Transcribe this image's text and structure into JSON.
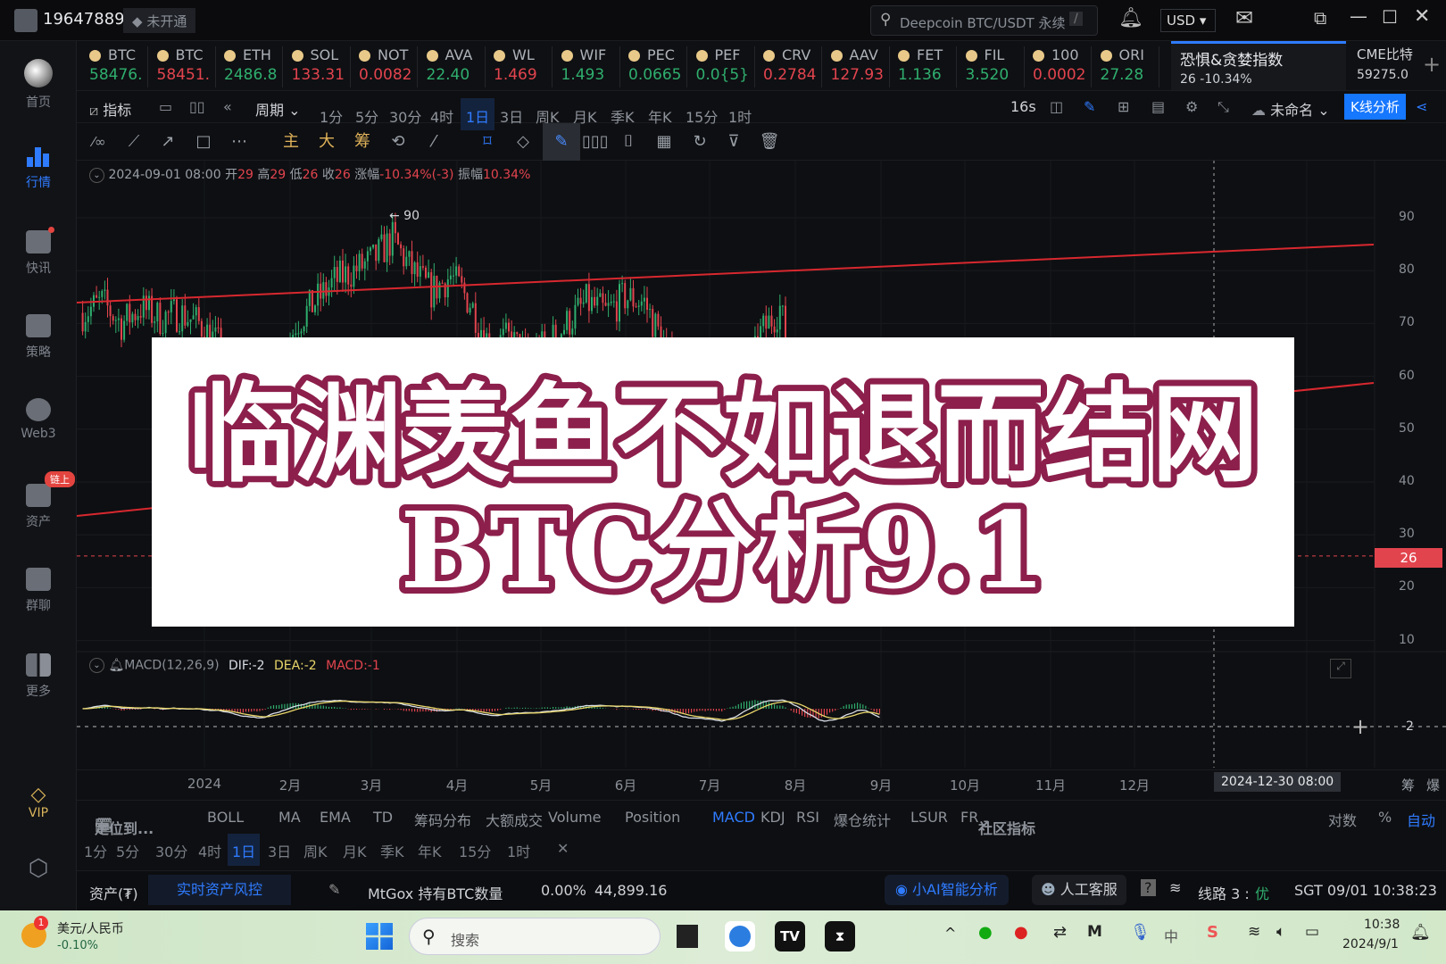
{
  "topbar": {
    "user_id": "19647889",
    "vip_status": "未开通",
    "search_placeholder": "Deepcoin BTC/USDT 永续",
    "search_shortcut": "/",
    "currency": "USD"
  },
  "sidebar": {
    "items": [
      {
        "label": "首页",
        "icon": "home-logo-icon"
      },
      {
        "label": "行情",
        "icon": "bar-chart-icon",
        "active": true
      },
      {
        "label": "快讯",
        "icon": "news-icon"
      },
      {
        "label": "策略",
        "icon": "robot-icon"
      },
      {
        "label": "Web3",
        "icon": "web3-icon"
      },
      {
        "label": "资产",
        "icon": "wallet-icon",
        "badge": "链上"
      },
      {
        "label": "群聊",
        "icon": "chat-icon"
      },
      {
        "label": "更多",
        "icon": "grid-icon"
      },
      {
        "label": "VIP",
        "icon": "diamond-icon"
      }
    ]
  },
  "ticker": [
    {
      "name": "BTC",
      "price": "58476.",
      "dir": "up"
    },
    {
      "name": "BTC",
      "price": "58451.",
      "dir": "down"
    },
    {
      "name": "ETH",
      "price": "2486.8",
      "dir": "up"
    },
    {
      "name": "SOL",
      "price": "133.31",
      "dir": "down"
    },
    {
      "name": "NOT",
      "price": "0.0082",
      "dir": "down"
    },
    {
      "name": "AVA",
      "price": "22.40",
      "dir": "up"
    },
    {
      "name": "WL",
      "price": "1.469",
      "dir": "down"
    },
    {
      "name": "WIF",
      "price": "1.493",
      "dir": "up"
    },
    {
      "name": "PEC",
      "price": "0.0665",
      "dir": "up"
    },
    {
      "name": "PEF",
      "price": "0.0{5}",
      "dir": "up"
    },
    {
      "name": "CRV",
      "price": "0.2784",
      "dir": "down"
    },
    {
      "name": "AAV",
      "price": "127.93",
      "dir": "down"
    },
    {
      "name": "FET",
      "price": "1.136",
      "dir": "up"
    },
    {
      "name": "FIL",
      "price": "3.520",
      "dir": "up"
    },
    {
      "name": "100",
      "price": "0.0002",
      "dir": "down"
    },
    {
      "name": "ORI",
      "price": "27.28",
      "dir": "up"
    }
  ],
  "fear_greed": {
    "title": "恐惧&贪婪指数",
    "value": "26 -10.34%"
  },
  "cme": {
    "title": "CME比特",
    "value": "59275.0"
  },
  "toolbar": {
    "indicators": "指标",
    "period": "周期",
    "periods": [
      "1分",
      "5分",
      "30分",
      "4时",
      "1日",
      "3日",
      "周K",
      "月K",
      "季K",
      "年K",
      "15分",
      "1时"
    ],
    "active_period": "1日",
    "refresh": "16s",
    "layout_name": "未命名",
    "kline_analysis": "K线分析",
    "main": "主",
    "big": "大",
    "chip": "筹"
  },
  "info": {
    "date": "2024-09-01 08:00",
    "open_label": "开",
    "open": "29",
    "high_label": "高",
    "high": "29",
    "low_label": "低",
    "low": "26",
    "close_label": "收",
    "close": "26",
    "change_label": "涨幅",
    "change": "-10.34%(-3)",
    "amp_label": "振幅",
    "amp": "10.34%"
  },
  "overlay": {
    "line1": "临渊羡鱼不如退而结网",
    "line2": "BTC分析9.1"
  },
  "macd": {
    "title": "MACD(12,26,9)",
    "dif": "DIF:-2",
    "dea": "DEA:-2",
    "macd": "MACD:-1",
    "axis_label": "-2"
  },
  "colors": {
    "up": "#2fae6e",
    "down": "#e2444e",
    "accent": "#2f7bff",
    "dif": "#d8dde6",
    "dea": "#e8d66a",
    "trendline": "#d8282f",
    "overlay_stroke": "#8c1f4b"
  },
  "chart_data": {
    "type": "candlestick",
    "yaxis": {
      "ticks": [
        90,
        80,
        70,
        60,
        50,
        40,
        30,
        20,
        10
      ],
      "range": [
        10,
        90
      ]
    },
    "last_price": "26",
    "peak_label": "← 90",
    "xaxis_ticks": [
      "2024",
      "2月",
      "3月",
      "4月",
      "5月",
      "6月",
      "7月",
      "8月",
      "9月",
      "10月",
      "11月",
      "12月",
      "2月"
    ],
    "crosshair_time": "2024-12-30 08:00",
    "weekly_close": [
      [
        "2023-11-18",
        72
      ],
      [
        "2023-11-25",
        74
      ],
      [
        "2023-12-02",
        70
      ],
      [
        "2023-12-09",
        73
      ],
      [
        "2023-12-16",
        71
      ],
      [
        "2023-12-23",
        72
      ],
      [
        "2023-12-30",
        70
      ],
      [
        "2024-01-06",
        66
      ],
      [
        "2024-01-13",
        55
      ],
      [
        "2024-01-20",
        50
      ],
      [
        "2024-01-27",
        60
      ],
      [
        "2024-02-03",
        70
      ],
      [
        "2024-02-10",
        74
      ],
      [
        "2024-02-17",
        78
      ],
      [
        "2024-02-24",
        80
      ],
      [
        "2024-03-02",
        82
      ],
      [
        "2024-03-09",
        86
      ],
      [
        "2024-03-16",
        80
      ],
      [
        "2024-03-23",
        76
      ],
      [
        "2024-03-30",
        79
      ],
      [
        "2024-04-06",
        74
      ],
      [
        "2024-04-13",
        66
      ],
      [
        "2024-04-20",
        67
      ],
      [
        "2024-04-27",
        64
      ],
      [
        "2024-05-04",
        66
      ],
      [
        "2024-05-11",
        70
      ],
      [
        "2024-05-18",
        74
      ],
      [
        "2024-05-25",
        72
      ],
      [
        "2024-06-01",
        75
      ],
      [
        "2024-06-08",
        74
      ],
      [
        "2024-06-15",
        66
      ],
      [
        "2024-06-22",
        55
      ],
      [
        "2024-06-29",
        48
      ],
      [
        "2024-07-06",
        40
      ],
      [
        "2024-07-13",
        55
      ],
      [
        "2024-07-20",
        68
      ],
      [
        "2024-07-27",
        73
      ],
      [
        "2024-08-03",
        55
      ],
      [
        "2024-08-10",
        35
      ],
      [
        "2024-08-17",
        42
      ],
      [
        "2024-08-24",
        52
      ],
      [
        "2024-08-31",
        29
      ],
      [
        "2024-09-01",
        26
      ]
    ]
  },
  "indicators": {
    "locate": "定位到...",
    "main": [
      "BOLL",
      "MA",
      "EMA",
      "TD",
      "筹码分布",
      "大额成交"
    ],
    "sub": [
      "Volume",
      "Position",
      "MACD",
      "KDJ",
      "RSI",
      "爆仓统计",
      "LSUR",
      "FR"
    ],
    "active": "MACD",
    "community": "社区指标",
    "log": "对数",
    "percent": "%",
    "auto": "自动",
    "right_labels": [
      "筹",
      "爆"
    ]
  },
  "status": {
    "assets": "资产(₮)",
    "risk": "实时资产风控",
    "mtgox": "MtGox 持有BTC数量",
    "mtgox_pct": "0.00%",
    "mtgox_val": "44,899.16",
    "ai": "小AI智能分析",
    "service": "人工客服",
    "line": "线路 3 :",
    "line_quality": "优",
    "time": "SGT 09/01 10:38:23"
  },
  "taskbar": {
    "fx_name": "美元/人民币",
    "fx_change": "-0.10%",
    "fx_badge": "1",
    "search": "搜索",
    "ime": "中",
    "time": "10:38",
    "date": "2024/9/1"
  }
}
